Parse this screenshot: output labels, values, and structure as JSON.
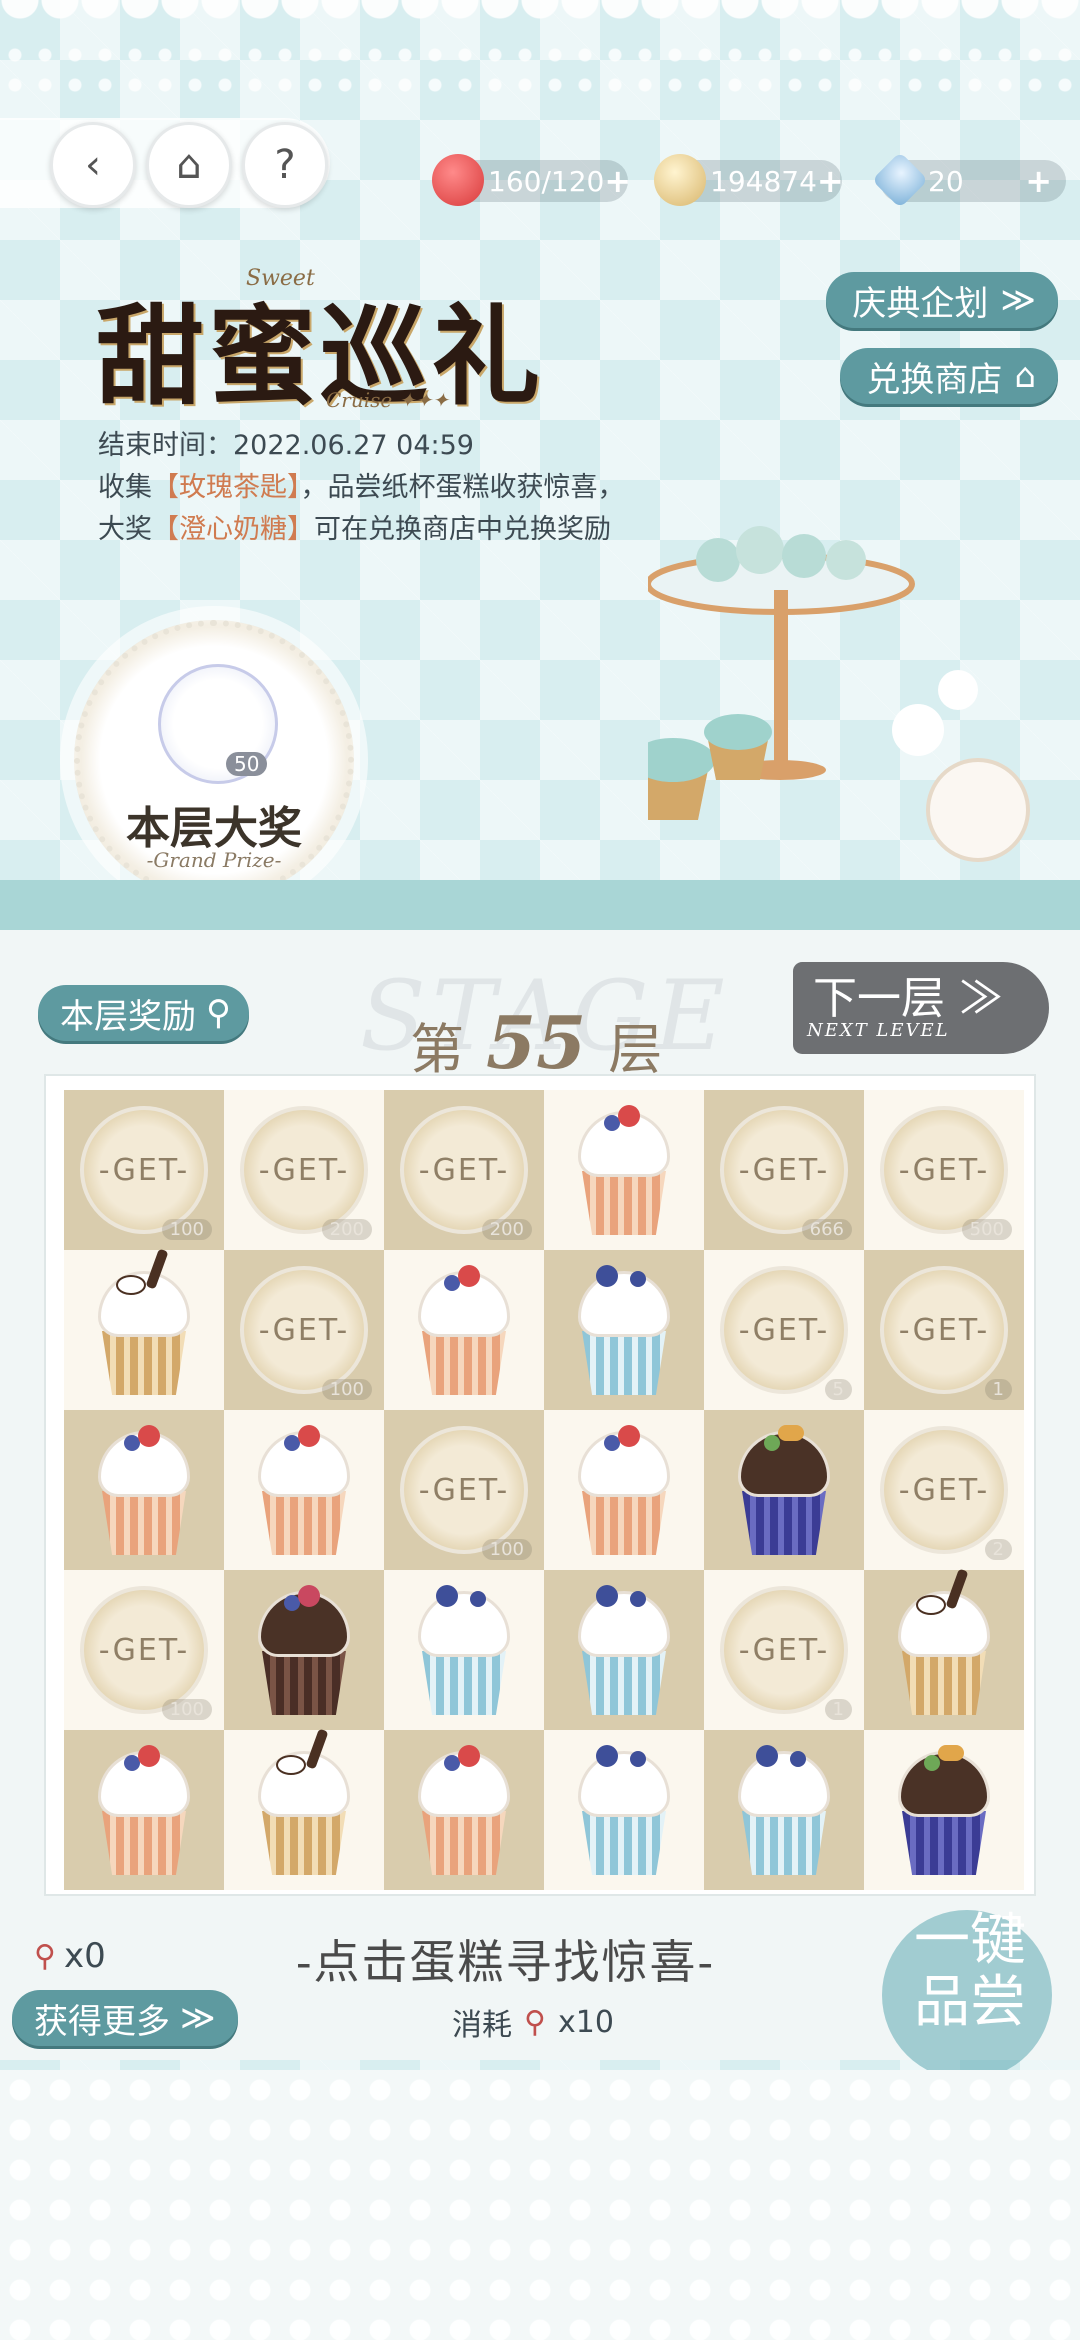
{
  "nav": {
    "back_glyph": "‹",
    "home_glyph": "⌂",
    "help_glyph": "?"
  },
  "currencies": [
    {
      "name": "apple-stamina",
      "value": "160/120",
      "color": "#d83a3a"
    },
    {
      "name": "gold-coin",
      "value": "194874",
      "color": "#e4c77f"
    },
    {
      "name": "crystal",
      "value": "20",
      "color": "#7ab0d8"
    }
  ],
  "side_buttons": {
    "festival_plan": "庆典企划",
    "exchange_shop": "兑换商店"
  },
  "event": {
    "title": "甜蜜巡礼",
    "sub_sweet": "Sweet",
    "sub_cruise": "Cruise ✦✦✦",
    "end_time": "结束时间：2022.06.27 04:59",
    "desc_1": "收集",
    "desc_hl_1": "【玫瑰茶匙】",
    "desc_2": "，品尝纸杯蛋糕收获惊喜，大奖",
    "desc_hl_2": "【澄心奶糖】",
    "desc_3": "可在兑换商店中兑换奖励"
  },
  "grand_prize": {
    "count": "50",
    "title": "本层大奖",
    "subtitle": "-Grand Prize-"
  },
  "stage": {
    "layer_reward_label": "本层奖励",
    "watermark": "STAGE",
    "prefix": "第",
    "number": "55",
    "suffix": "层",
    "next_main": "下一层 ≫",
    "next_sub": "NEXT LEVEL"
  },
  "grid": [
    [
      {
        "t": "get",
        "c": "100"
      },
      {
        "t": "get",
        "c": "200"
      },
      {
        "t": "get",
        "c": "200"
      },
      {
        "t": "cake",
        "k": "berry"
      },
      {
        "t": "get",
        "c": "666"
      },
      {
        "t": "get",
        "c": "500"
      }
    ],
    [
      {
        "t": "cake",
        "k": "pipe"
      },
      {
        "t": "get",
        "c": "100"
      },
      {
        "t": "cake",
        "k": "berry"
      },
      {
        "t": "cake",
        "k": "blueb"
      },
      {
        "t": "get",
        "c": "5"
      },
      {
        "t": "get",
        "c": "1"
      }
    ],
    [
      {
        "t": "cake",
        "k": "berry"
      },
      {
        "t": "cake",
        "k": "berry"
      },
      {
        "t": "get",
        "c": "100"
      },
      {
        "t": "cake",
        "k": "berry"
      },
      {
        "t": "cake",
        "k": "orange"
      },
      {
        "t": "get",
        "c": "2"
      }
    ],
    [
      {
        "t": "get",
        "c": "100"
      },
      {
        "t": "cake",
        "k": "rose"
      },
      {
        "t": "cake",
        "k": "blueb"
      },
      {
        "t": "cake",
        "k": "blueb"
      },
      {
        "t": "get",
        "c": "1"
      },
      {
        "t": "cake",
        "k": "pipe"
      }
    ],
    [
      {
        "t": "cake",
        "k": "berry"
      },
      {
        "t": "cake",
        "k": "pipe"
      },
      {
        "t": "cake",
        "k": "berry"
      },
      {
        "t": "cake",
        "k": "blueb"
      },
      {
        "t": "cake",
        "k": "blueb"
      },
      {
        "t": "cake",
        "k": "orange"
      }
    ]
  ],
  "get_label": "GET",
  "bottom": {
    "spoon_count": "x0",
    "get_more": "获得更多",
    "tap_hint": "-点击蛋糕寻找惊喜-",
    "consume_label": "消耗",
    "consume_count": "x10",
    "one_key_1": "一键",
    "one_key_2": "品尝"
  },
  "colors": {
    "accent_teal": "#5e9aa0",
    "highlight_orange": "#d07b50"
  }
}
